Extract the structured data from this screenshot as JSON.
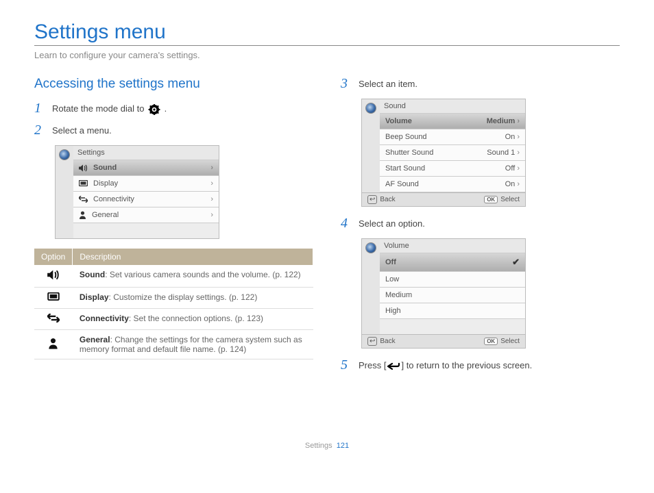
{
  "title": "Settings menu",
  "subtitle": "Learn to configure your camera's settings.",
  "section_title": "Accessing the settings menu",
  "steps": {
    "s1": "Rotate the mode dial to ",
    "s1_tail": ".",
    "s2": "Select a menu.",
    "s3": "Select an item.",
    "s4": "Select an option.",
    "s5a": "Press [",
    "s5b": "] to return to the previous screen."
  },
  "panel_settings": {
    "title": "Settings",
    "items": [
      {
        "label": "Sound"
      },
      {
        "label": "Display"
      },
      {
        "label": "Connectivity"
      },
      {
        "label": "General"
      }
    ]
  },
  "panel_sound": {
    "title": "Sound",
    "items": [
      {
        "label": "Volume",
        "value": "Medium"
      },
      {
        "label": "Beep Sound",
        "value": "On"
      },
      {
        "label": "Shutter Sound",
        "value": "Sound 1"
      },
      {
        "label": "Start Sound",
        "value": "Off"
      },
      {
        "label": "AF Sound",
        "value": "On"
      }
    ],
    "footer": {
      "back": "Back",
      "select": "Select"
    }
  },
  "panel_volume": {
    "title": "Volume",
    "options": [
      "Off",
      "Low",
      "Medium",
      "High"
    ],
    "footer": {
      "back": "Back",
      "select": "Select"
    }
  },
  "desc_header": {
    "option": "Option",
    "description": "Description"
  },
  "desc": [
    {
      "title": "Sound",
      "text": ": Set various camera sounds and the volume. (p. 122)"
    },
    {
      "title": "Display",
      "text": ": Customize the display settings. (p. 122)"
    },
    {
      "title": "Connectivity",
      "text": ": Set the connection options. (p. 123)"
    },
    {
      "title": "General",
      "text": ": Change the settings for the camera system such as memory format and default file name. (p. 124)"
    }
  ],
  "footer": {
    "section": "Settings",
    "page": "121"
  }
}
